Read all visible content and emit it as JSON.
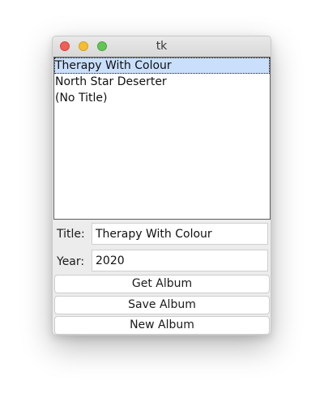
{
  "window": {
    "title": "tk"
  },
  "listbox": {
    "items": [
      {
        "label": "Therapy With Colour",
        "selected": true
      },
      {
        "label": "North Star Deserter",
        "selected": false
      },
      {
        "label": "(No Title)",
        "selected": false
      }
    ]
  },
  "form": {
    "title_label": "Title:",
    "title_value": "Therapy With Colour",
    "year_label": "Year:",
    "year_value": "2020"
  },
  "buttons": {
    "get_album": "Get Album",
    "save_album": "Save Album",
    "new_album": "New Album"
  },
  "colors": {
    "selection": "#c9dffb",
    "close": "#ee5f57",
    "minimize": "#f5be2f",
    "maximize": "#62c554"
  }
}
